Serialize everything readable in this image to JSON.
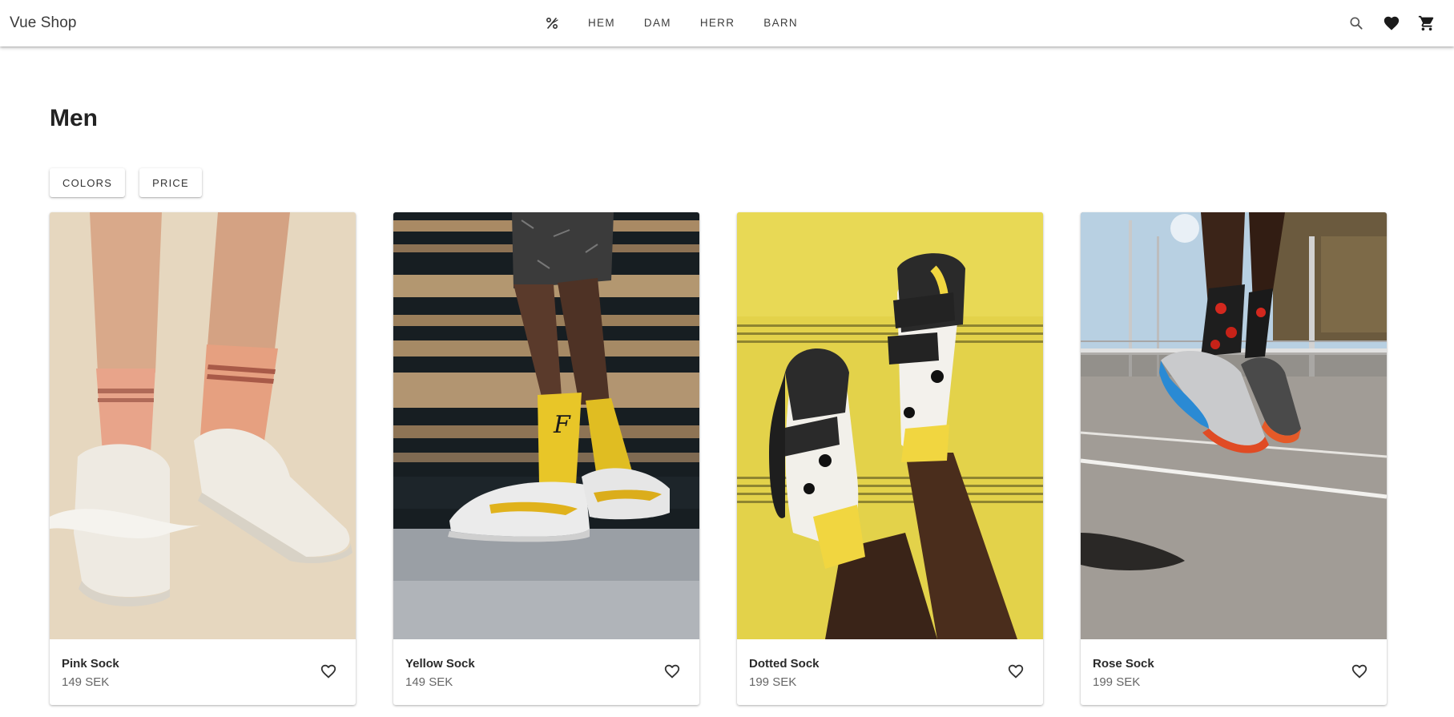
{
  "header": {
    "brand": "Vue Shop",
    "sale_icon": "percent-icon",
    "nav": [
      "HEM",
      "DAM",
      "HERR",
      "BARN"
    ],
    "actions": [
      "search-icon",
      "heart-icon",
      "cart-icon"
    ]
  },
  "page": {
    "title": "Men"
  },
  "filters": {
    "colors_label": "COLORS",
    "price_label": "PRICE"
  },
  "products": [
    {
      "name": "Pink Sock",
      "price": "149 SEK",
      "favorite_icon": "heart-outline-icon"
    },
    {
      "name": "Yellow Sock",
      "price": "149 SEK",
      "favorite_icon": "heart-outline-icon"
    },
    {
      "name": "Dotted Sock",
      "price": "199 SEK",
      "favorite_icon": "heart-outline-icon"
    },
    {
      "name": "Rose Sock",
      "price": "199 SEK",
      "favorite_icon": "heart-outline-icon"
    }
  ]
}
